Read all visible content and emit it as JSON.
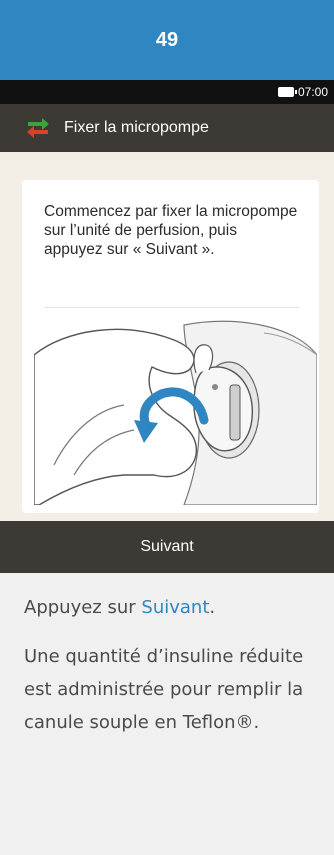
{
  "step_header": {
    "number": "49"
  },
  "status_bar": {
    "time": "07:00",
    "battery_icon": "battery-icon"
  },
  "screen": {
    "title": "Fixer la micropompe",
    "title_icon": "swap-arrows-icon",
    "instruction": "Commencez par fixer la micropompe sur l’unité de perfusion, puis appuyez sur « Suivant ».",
    "next_button_label": "Suivant"
  },
  "notes": {
    "first_prefix": "Appuyez sur ",
    "first_link": "Suivant",
    "first_suffix": ".",
    "second": "Une quantité d’insuline réduite est administrée pour remplir la canule souple en Teflon®."
  },
  "colors": {
    "header_blue": "#2f86c0",
    "dark_bar": "#3d3a36",
    "arrow_green": "#3aa53a",
    "arrow_red": "#e0402a",
    "rotate_arrow_blue": "#2f86c0"
  }
}
